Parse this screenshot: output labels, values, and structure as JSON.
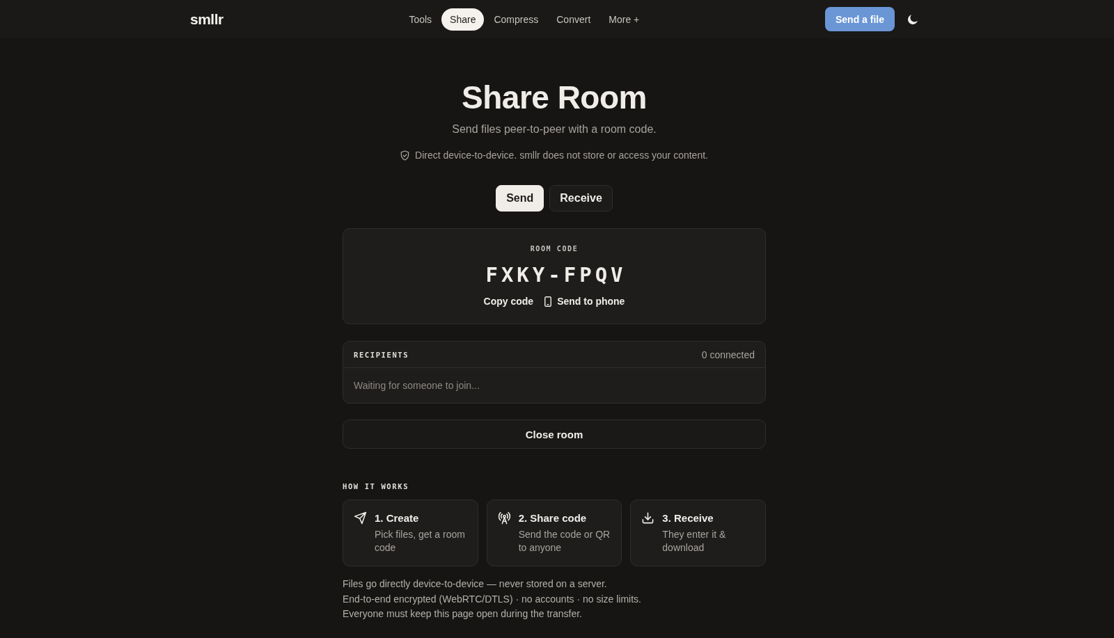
{
  "header": {
    "logo": "smllr",
    "nav": [
      {
        "label": "Tools",
        "selected": false
      },
      {
        "label": "Share",
        "selected": true
      },
      {
        "label": "Compress",
        "selected": false
      },
      {
        "label": "Convert",
        "selected": false
      },
      {
        "label": "More +",
        "selected": false
      }
    ],
    "cta": "Send a file"
  },
  "hero": {
    "title": "Share Room",
    "subtitle": "Send files peer-to-peer with a room code.",
    "notice": "Direct device-to-device. smllr does not store or access your content."
  },
  "mode_tabs": [
    {
      "label": "Send",
      "selected": true
    },
    {
      "label": "Receive",
      "selected": false
    }
  ],
  "room_card": {
    "label": "ROOM CODE",
    "code": "FXKY-FPQV",
    "actions": [
      {
        "kind": "plain",
        "label": "Copy code"
      },
      {
        "kind": "phone",
        "label": "Send to phone"
      }
    ]
  },
  "recipients": {
    "title": "RECIPIENTS",
    "count": "0 connected",
    "empty_message": "Waiting for someone to join..."
  },
  "close_button": "Close room",
  "how_it_works": {
    "title": "HOW IT WORKS",
    "steps": [
      {
        "kind": "send",
        "title": "1. Create",
        "text": "Pick files, get a room code"
      },
      {
        "kind": "broadcast",
        "title": "2. Share code",
        "text": "Send the code or QR to anyone"
      },
      {
        "kind": "download",
        "title": "3. Receive",
        "text": "They enter it & download"
      }
    ]
  },
  "notes": [
    "Files go directly device-to-device — never stored on a server.",
    "End-to-end encrypted (WebRTC/DTLS) · no accounts · no size limits.",
    "Everyone must keep this page open during the transfer."
  ]
}
